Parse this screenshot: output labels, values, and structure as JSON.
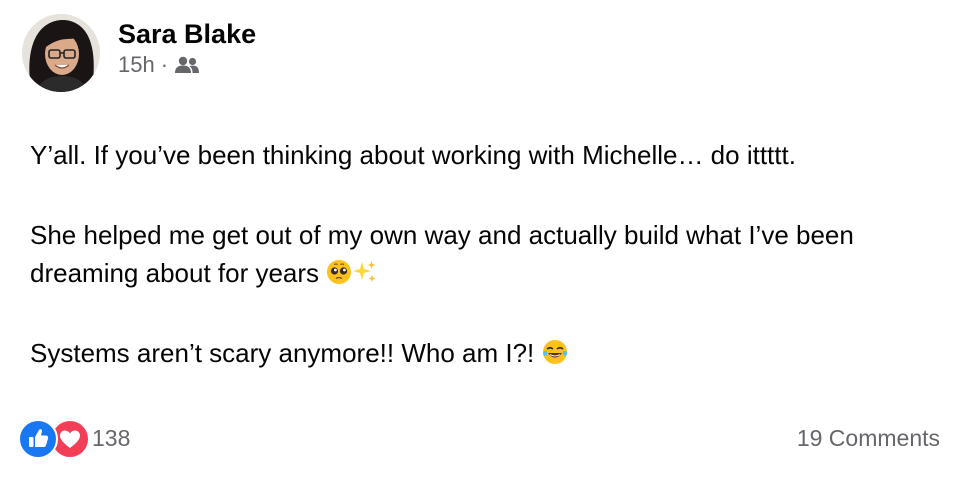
{
  "post": {
    "author": "Sara Blake",
    "time": "15h",
    "separator": "·",
    "audience_icon": "friends-icon",
    "paragraphs": [
      {
        "text": "Y’all. If you’ve been thinking about working with Michelle… do ittttt.",
        "emojis": []
      },
      {
        "text": "She helped me get out of my own way and actually build what I’ve been dreaming about for years",
        "emojis": [
          "pleading-face-emoji",
          "sparkles-emoji"
        ]
      },
      {
        "text": "Systems aren’t scary anymore!! Who am I?!",
        "emojis": [
          "tears-of-joy-emoji"
        ]
      }
    ],
    "reactions": {
      "icons": [
        "like-icon",
        "love-icon"
      ],
      "count": "138"
    },
    "comments_label": "19 Comments"
  },
  "colors": {
    "like": "#1877f2",
    "love": "#f33e58",
    "secondary_text": "#65676b",
    "primary_text": "#050505"
  }
}
